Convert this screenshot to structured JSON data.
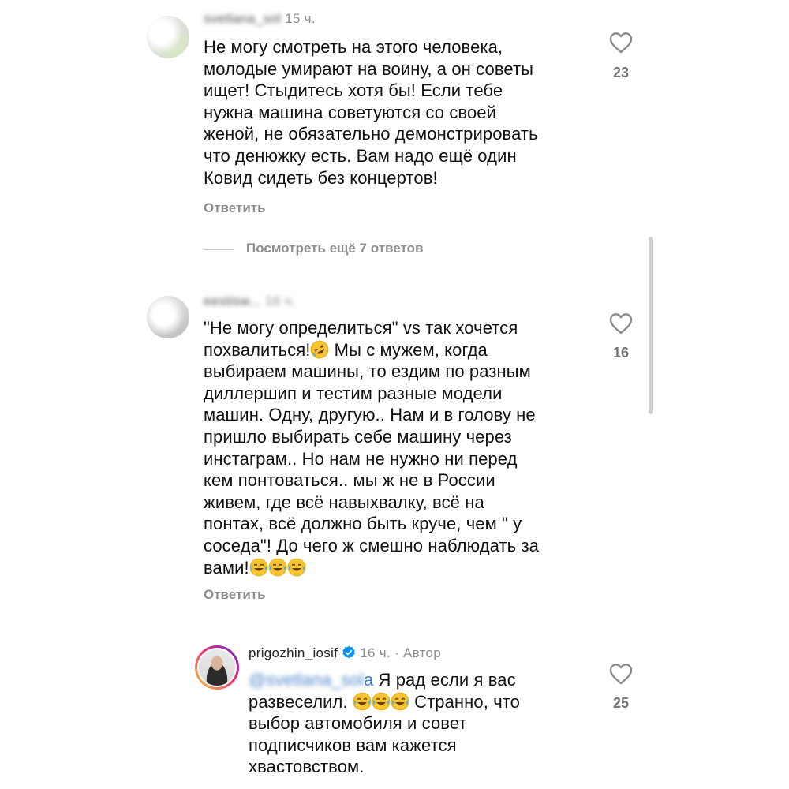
{
  "comments": [
    {
      "username_blurred": "svetlana_sol",
      "time": "15 ч.",
      "text_lines": [
        "Не могу смотреть на этого человека,",
        "молодые умирают на воину, а он советы",
        "ищет! Стыдитесь хотя бы! Если тебе",
        "нужна машина советуются со своей",
        "женой, не обязательно демонстрировать",
        "что денюжку есть. Вам надо ещё один",
        "Ковид сидеть без концертов!"
      ],
      "likes": "23",
      "reply_label": "Ответить"
    },
    {
      "username_blurred": "eestisw...",
      "time": "16 ч.",
      "text_lines": [
        "\"Не могу определиться\" vs так хочется",
        "похвалиться!",
        "выбираем машины, то ездим по разным",
        "диллершип и тестим разные модели",
        "машин. Одну, другую.. Нам и в голову не",
        "пришло выбирать себе машину через",
        "инстаграм.. Но нам не нужно ни перед",
        "кем понтоваться.. мы ж не в России",
        "живем, где всё навыхвалку, всё на",
        "понтах, всё должно быть круче, чем \" у",
        "соседа\"! До чего ж смешно наблюдать за",
        "вами!"
      ],
      "line2_suffix": " Мы с мужем, когда",
      "likes": "16",
      "reply_label": "Ответить"
    }
  ],
  "view_more": "Посмотреть ещё 7 ответов",
  "reply": {
    "username": "prigozhin_iosif",
    "time": "16 ч.",
    "separator": "·",
    "author_label": "Автор",
    "mention_suffix": "а",
    "line1": " Я рад если я вас",
    "line2_prefix": "развеселил.",
    "line2_suffix": " Странно, что",
    "line3": "выбор автомобиля и совет",
    "line4": "подписчиков вам кажется",
    "line5": "хвастовством.",
    "likes": "25"
  },
  "icons": {
    "like": "heart-outline-icon",
    "emoji_rofl": "rolling-on-floor-laughing-emoji",
    "emoji_joy": "face-with-tears-of-joy-emoji",
    "verified": "verified-badge-icon"
  },
  "colors": {
    "secondary_text": "#8e8e8e",
    "mention": "#3b82c6",
    "verified": "#0095f6"
  }
}
